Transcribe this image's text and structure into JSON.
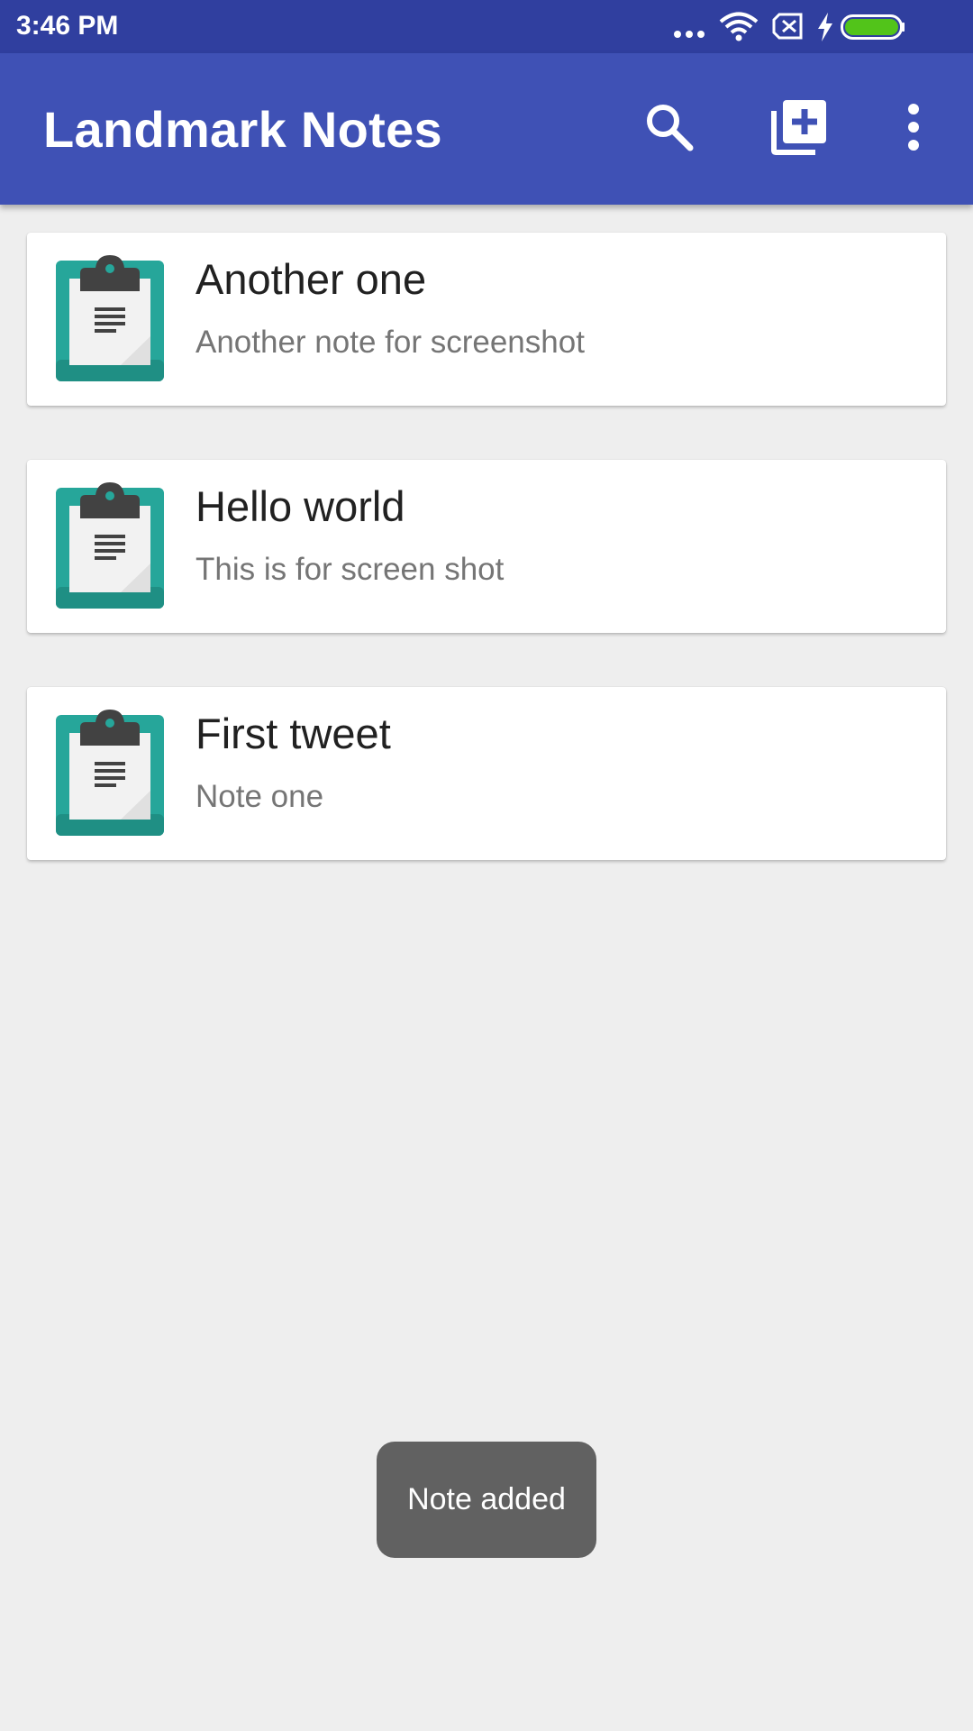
{
  "status_bar": {
    "time": "3:46 PM",
    "icons": [
      "more-dots-icon",
      "wifi-icon",
      "no-sim-icon",
      "charging-bolt-icon",
      "battery-icon"
    ],
    "battery_color": "#52c41a"
  },
  "app_bar": {
    "title": "Landmark Notes",
    "background": "#3f51b5",
    "actions": [
      "search-icon",
      "add-note-icon",
      "overflow-menu-icon"
    ]
  },
  "notes": [
    {
      "title": "Another one",
      "body": "Another note for screenshot",
      "icon": "clipboard-icon"
    },
    {
      "title": "Hello world",
      "body": "This is for screen shot",
      "icon": "clipboard-icon"
    },
    {
      "title": "First tweet",
      "body": "Note one",
      "icon": "clipboard-icon"
    }
  ],
  "toast": {
    "message": "Note added"
  },
  "colors": {
    "status_bar": "#303f9f",
    "clipboard_teal": "#26a69a",
    "clipboard_clip": "#424242",
    "background": "#eeeeee"
  }
}
